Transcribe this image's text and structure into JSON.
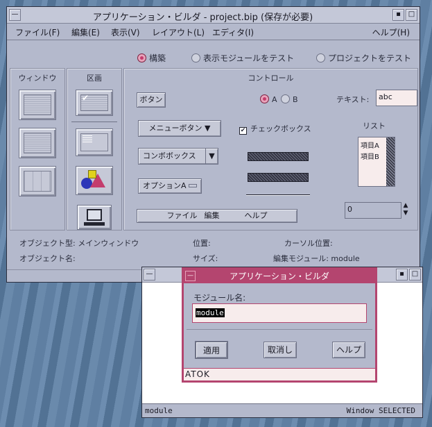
{
  "main_window": {
    "title": "アプリケーション・ビルダ - project.bip (保存が必要)",
    "menus": [
      "ファイル(F)",
      "編集(E)",
      "表示(V)",
      "レイアウト(L)",
      "エディタ(I)",
      "ヘルプ(H)"
    ],
    "modes": [
      "構築",
      "表示モジュールをテスト",
      "プロジェクトをテスト"
    ],
    "palette": {
      "windows_title": "ウィンドウ",
      "panes_title": "区画",
      "controls_title": "コントロール",
      "button_label": "ボタン",
      "radio_a": "A",
      "radio_b": "B",
      "text_label": "テキスト:",
      "text_value": "abc",
      "menu_button_label": "メニューボタン",
      "checkbox_label": "チェックボックス",
      "list_title": "リスト",
      "list_items": [
        "項目A",
        "項目B"
      ],
      "combo_label": "コンボボックス",
      "option_label": "オプションA",
      "spin_value": "0",
      "menubar_items": [
        "ファイル",
        "編集",
        "ヘルプ"
      ]
    },
    "status": {
      "object_type": "オブジェクト型: メインウィンドウ",
      "object_name": "オブジェクト名:",
      "position": "位置:",
      "size": "サイズ:",
      "cursor_position": "カーソル位置:",
      "edit_module": "編集モジュール: module"
    }
  },
  "back_window": {
    "footer_left": "module",
    "footer_right": "Window SELECTED"
  },
  "dialog": {
    "title": "アプリケーション・ビルダ",
    "field_label": "モジュール名:",
    "field_value": "module",
    "apply": "適用",
    "cancel": "取消し",
    "help": "ヘルプ",
    "ime": "ATOK"
  },
  "colors": {
    "accent": "#b4456f",
    "window_bg": "#b4b9cc"
  }
}
